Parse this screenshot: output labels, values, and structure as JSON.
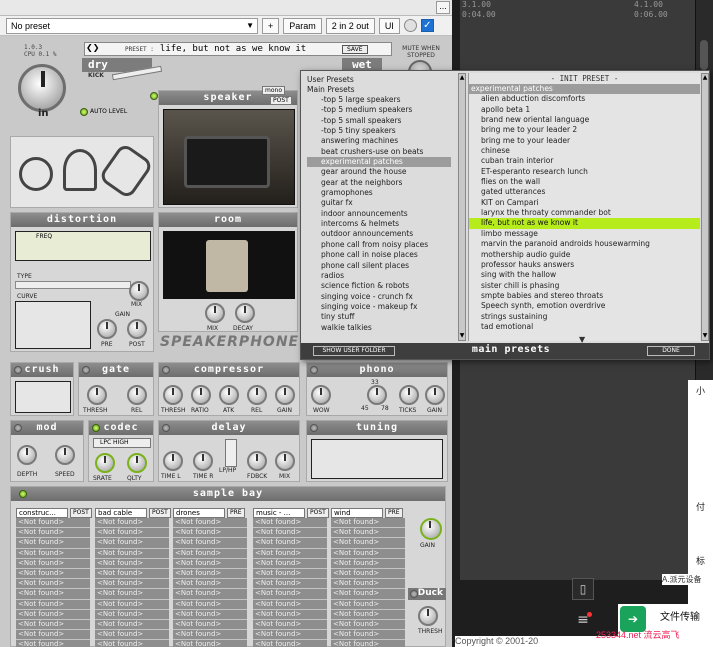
{
  "host": {
    "preset_select_value": "No preset",
    "plus_label": "+",
    "param_label": "Param",
    "io_label": "2 in 2 out",
    "ui_label": "UI",
    "dots_label": "..."
  },
  "plugin": {
    "version": "1.0.3",
    "cpu": "CPU 0.1 %",
    "preset_caption": "PRESET :",
    "preset_name": "life, but not as we know it",
    "save_label": "SAVE",
    "mute_label": "MUTE WHEN STOPPED",
    "dry_label": "dry",
    "wet_label": "wet",
    "kick_label": "KICK",
    "in_label": "in",
    "auto_level_label": "AUTO LEVEL",
    "speaker": {
      "title": "speaker",
      "mono": "mono",
      "post": "POST"
    },
    "distortion": {
      "title": "distortion",
      "freq": "FREQ",
      "type": "TYPE",
      "curve": "CURVE",
      "mix": "MIX",
      "gain": "GAIN",
      "pre": "PRE",
      "post": "POST"
    },
    "room": {
      "title": "room",
      "mix": "MIX",
      "decay": "DECAY"
    },
    "brand": "SPEAKERPHONE",
    "crush": {
      "title": "crush"
    },
    "gate": {
      "title": "gate",
      "thresh": "THRESH",
      "rel": "REL"
    },
    "compressor": {
      "title": "compressor",
      "thresh": "THRESH",
      "ratio": "RATIO",
      "atk": "ATK",
      "rel": "REL",
      "gain": "GAIN"
    },
    "phono": {
      "title": "phono",
      "wow": "WOW",
      "speed1": "33",
      "speed2": "45",
      "speed3": "78",
      "ticks": "TICKS",
      "gain": "GAIN"
    },
    "mod": {
      "title": "mod",
      "depth": "DEPTH",
      "speed": "SPEED"
    },
    "codec": {
      "title": "codec",
      "mode": "LPC HIGH",
      "srate": "SRATE",
      "qlty": "QLTY"
    },
    "delay": {
      "title": "delay",
      "timel": "TIME L",
      "timer": "TIME R",
      "lphp": "LP/HP",
      "fdbck": "FDBCK",
      "mix": "MIX"
    },
    "tuning": {
      "title": "tuning"
    },
    "sample_bay": {
      "title": "sample bay",
      "gain": "GAIN",
      "duck": "Duck",
      "thresh": "THRESH",
      "columns": [
        {
          "name": "construc...",
          "mode": "POST"
        },
        {
          "name": "bad cable",
          "mode": "POST"
        },
        {
          "name": "drones",
          "mode": "PRE"
        },
        {
          "name": "music - ...",
          "mode": "POST"
        },
        {
          "name": "wind",
          "mode": "PRE"
        }
      ],
      "slot_text": "<Not found>"
    }
  },
  "browser": {
    "user_presets": "User Presets",
    "main_presets_head": "Main Presets",
    "categories": [
      "-top 5 large speakers",
      "-top 5 medium speakers",
      "-top 5 small speakers",
      "-top 5 tiny speakers",
      "answering machines",
      "beat crushers-use on beats",
      "experimental patches",
      "gear around the house",
      "gear at the neighbors",
      "gramophones",
      "guitar fx",
      "indoor announcements",
      "intercoms & helmets",
      "outdoor announcements",
      "phone call from noisy places",
      "phone call in noise places",
      "phone call silent places",
      "radios",
      "science fiction & robots",
      "singing voice - crunch fx",
      "singing voice - makeup fx",
      "tiny stuff",
      "walkie talkies"
    ],
    "selected_category": "experimental patches",
    "init_title": "- INIT PRESET -",
    "list_header": "experimental patches",
    "presets": [
      "alien abduction discomforts",
      "apollo beta 1",
      "brand new oriental language",
      "bring me to your leader 2",
      "bring me to your leader",
      "chinese",
      "cuban train interior",
      "ET-esperanto research lunch",
      "flies on the wall",
      "gated utterances",
      "KIT on Campari",
      "larynx the throaty commander bot",
      "life, but not as we know it",
      "limbo message",
      "marvin the paranoid androids housewarming",
      "mothership audio guide",
      "professor hauks answers",
      "sing with the hallow",
      "sister chill is phasing",
      "smpte babies and stereo throats",
      "Speech synth, emotion overdrive",
      "strings sustaining",
      "tad emotional"
    ],
    "active_preset": "life, but not as we know it",
    "show_user_folder": "SHOW USER FOLDER",
    "main_presets_footer": "main presets",
    "done_label": "DONE"
  },
  "daw": {
    "time1a": "3.1.00",
    "time1b": "0:04.00",
    "time2a": "4.1.00",
    "time2b": "0:06.00",
    "copyright": "Copyright © 2001-20",
    "file_transfer": "文件传输",
    "watermark": "253344.net 流云高飞",
    "side1": "小",
    "side2": "付",
    "side3": "标",
    "side4": "A.派元设备"
  },
  "colors": {
    "accent_green": "#b7ec1c",
    "selection_gray": "#9c9c9c"
  }
}
